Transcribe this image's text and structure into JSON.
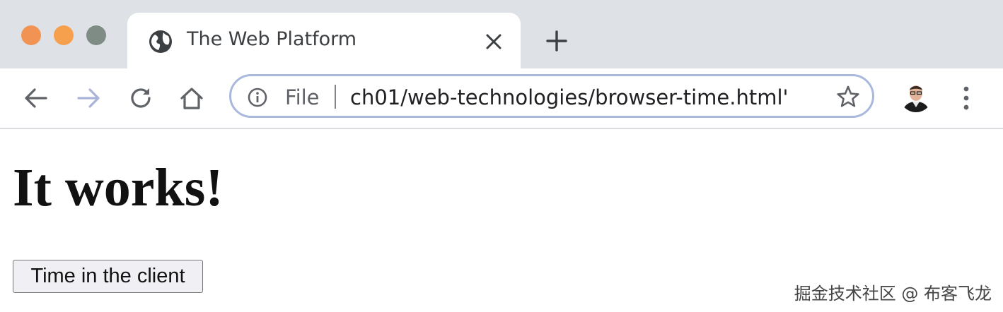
{
  "window": {
    "controls": [
      "close",
      "minimize",
      "zoom"
    ]
  },
  "tab": {
    "title": "The Web Platform",
    "favicon": "globe-icon",
    "close_icon": "close-icon"
  },
  "new_tab_icon": "plus-icon",
  "toolbar": {
    "back_icon": "arrow-left-icon",
    "forward_icon": "arrow-right-icon",
    "reload_icon": "reload-icon",
    "home_icon": "home-icon",
    "menu_icon": "kebab-menu-icon"
  },
  "omnibox": {
    "info_icon": "info-icon",
    "scheme": "File",
    "url": "'ch01/web-technologies/browser-time.html",
    "bookmark_icon": "star-icon"
  },
  "page": {
    "heading": "It works!",
    "button_label": "Time in the client"
  },
  "watermark": "掘金技术社区 @ 布客飞龙",
  "colors": {
    "tabstrip": "#dee1e6",
    "omnibox_border": "#a9b8dc",
    "traffic_close": "#f19453",
    "traffic_min": "#f6a04d",
    "traffic_max": "#7f8c85"
  }
}
